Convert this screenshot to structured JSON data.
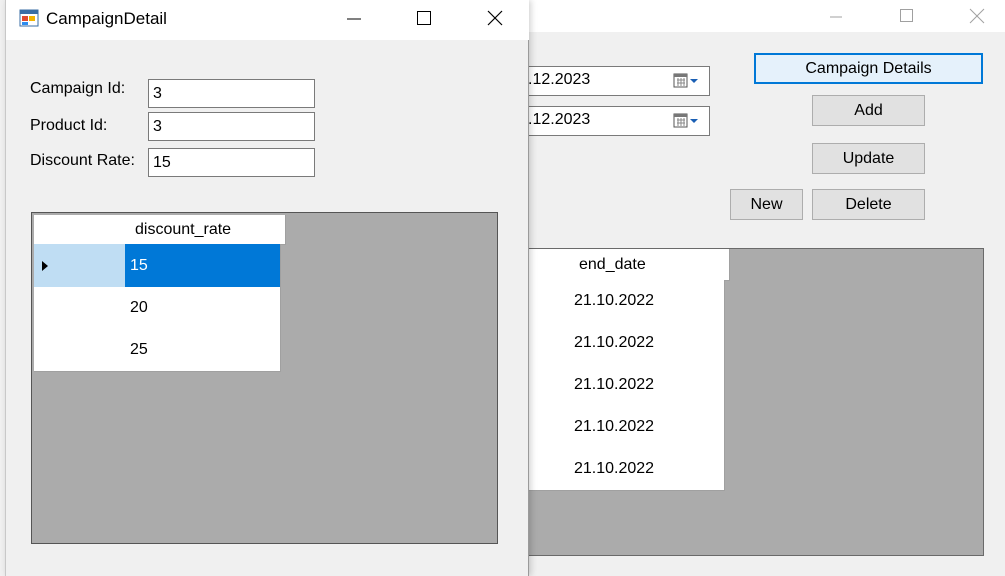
{
  "back_window": {
    "start_date_value": ".12.2023",
    "end_date_value": ".12.2023",
    "buttons": {
      "campaign_details": "Campaign Details",
      "add": "Add",
      "update": "Update",
      "new": "New",
      "delete": "Delete"
    },
    "grid": {
      "column_header": "end_date",
      "rows": [
        "21.10.2022",
        "21.10.2022",
        "21.10.2022",
        "21.10.2022",
        "21.10.2022"
      ]
    }
  },
  "front_window": {
    "title": "CampaignDetail",
    "labels": {
      "campaign_id": "Campaign Id:",
      "product_id": "Product Id:",
      "discount_rate": "Discount Rate:"
    },
    "fields": {
      "campaign_id": "3",
      "product_id": "3",
      "discount_rate": "15"
    },
    "grid": {
      "column_header": "discount_rate",
      "rows": [
        "15",
        "20",
        "25"
      ],
      "selected_row": 0
    }
  },
  "colors": {
    "selection": "#0078d7",
    "row_header_selected": "#bfddf3",
    "grid_background": "#ababab"
  }
}
